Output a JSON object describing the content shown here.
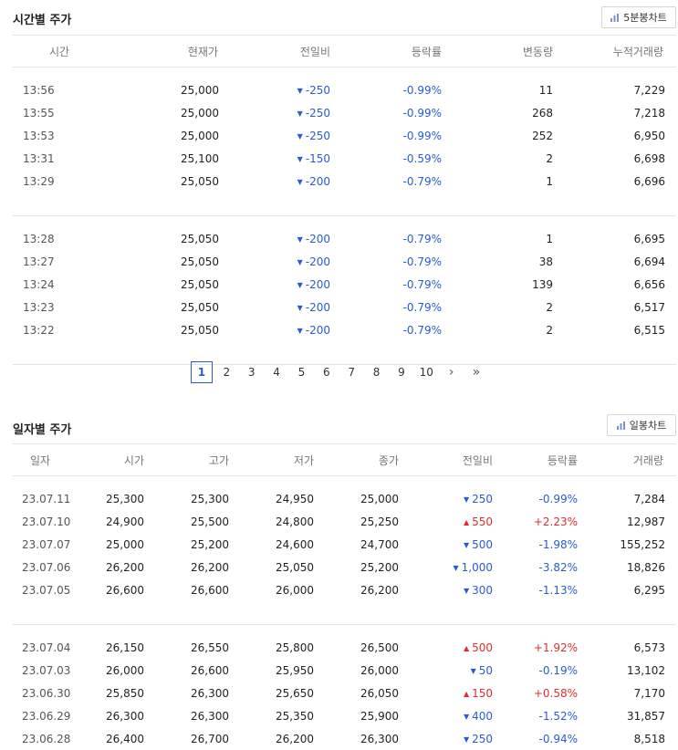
{
  "intraday": {
    "title": "시간별 주가",
    "chart_button": "5분봉차트",
    "columns": [
      "시간",
      "현재가",
      "전일비",
      "등락률",
      "변동량",
      "누적거래량"
    ],
    "groups": [
      [
        {
          "time": "13:56",
          "price": "25,000",
          "change": "-250",
          "rate": "-0.99%",
          "volume": "11",
          "cumulative": "7,229"
        },
        {
          "time": "13:55",
          "price": "25,000",
          "change": "-250",
          "rate": "-0.99%",
          "volume": "268",
          "cumulative": "7,218"
        },
        {
          "time": "13:53",
          "price": "25,000",
          "change": "-250",
          "rate": "-0.99%",
          "volume": "252",
          "cumulative": "6,950"
        },
        {
          "time": "13:31",
          "price": "25,100",
          "change": "-150",
          "rate": "-0.59%",
          "volume": "2",
          "cumulative": "6,698"
        },
        {
          "time": "13:29",
          "price": "25,050",
          "change": "-200",
          "rate": "-0.79%",
          "volume": "1",
          "cumulative": "6,696"
        }
      ],
      [
        {
          "time": "13:28",
          "price": "25,050",
          "change": "-200",
          "rate": "-0.79%",
          "volume": "1",
          "cumulative": "6,695"
        },
        {
          "time": "13:27",
          "price": "25,050",
          "change": "-200",
          "rate": "-0.79%",
          "volume": "38",
          "cumulative": "6,694"
        },
        {
          "time": "13:24",
          "price": "25,050",
          "change": "-200",
          "rate": "-0.79%",
          "volume": "139",
          "cumulative": "6,656"
        },
        {
          "time": "13:23",
          "price": "25,050",
          "change": "-200",
          "rate": "-0.79%",
          "volume": "2",
          "cumulative": "6,517"
        },
        {
          "time": "13:22",
          "price": "25,050",
          "change": "-200",
          "rate": "-0.79%",
          "volume": "2",
          "cumulative": "6,515"
        }
      ]
    ]
  },
  "pagination": {
    "pages": [
      "1",
      "2",
      "3",
      "4",
      "5",
      "6",
      "7",
      "8",
      "9",
      "10"
    ],
    "active": "1",
    "next": "›",
    "last": "»"
  },
  "daily": {
    "title": "일자별 주가",
    "chart_button": "일봉차트",
    "columns": [
      "일자",
      "시가",
      "고가",
      "저가",
      "종가",
      "전일비",
      "등락률",
      "거래량"
    ],
    "groups": [
      [
        {
          "date": "23.07.11",
          "open": "25,300",
          "high": "25,300",
          "low": "24,950",
          "close": "25,000",
          "dir": "down",
          "change": "250",
          "rate": "-0.99%",
          "volume": "7,284"
        },
        {
          "date": "23.07.10",
          "open": "24,900",
          "high": "25,500",
          "low": "24,800",
          "close": "25,250",
          "dir": "up",
          "change": "550",
          "rate": "+2.23%",
          "volume": "12,987"
        },
        {
          "date": "23.07.07",
          "open": "25,000",
          "high": "25,200",
          "low": "24,600",
          "close": "24,700",
          "dir": "down",
          "change": "500",
          "rate": "-1.98%",
          "volume": "155,252"
        },
        {
          "date": "23.07.06",
          "open": "26,200",
          "high": "26,200",
          "low": "25,050",
          "close": "25,200",
          "dir": "down",
          "change": "1,000",
          "rate": "-3.82%",
          "volume": "18,826"
        },
        {
          "date": "23.07.05",
          "open": "26,600",
          "high": "26,600",
          "low": "26,000",
          "close": "26,200",
          "dir": "down",
          "change": "300",
          "rate": "-1.13%",
          "volume": "6,295"
        }
      ],
      [
        {
          "date": "23.07.04",
          "open": "26,150",
          "high": "26,550",
          "low": "25,800",
          "close": "26,500",
          "dir": "up",
          "change": "500",
          "rate": "+1.92%",
          "volume": "6,573"
        },
        {
          "date": "23.07.03",
          "open": "26,000",
          "high": "26,600",
          "low": "25,950",
          "close": "26,000",
          "dir": "down",
          "change": "50",
          "rate": "-0.19%",
          "volume": "13,102"
        },
        {
          "date": "23.06.30",
          "open": "25,850",
          "high": "26,300",
          "low": "25,650",
          "close": "26,050",
          "dir": "up",
          "change": "150",
          "rate": "+0.58%",
          "volume": "7,170"
        },
        {
          "date": "23.06.29",
          "open": "26,300",
          "high": "26,300",
          "low": "25,350",
          "close": "25,900",
          "dir": "down",
          "change": "400",
          "rate": "-1.52%",
          "volume": "31,857"
        },
        {
          "date": "23.06.28",
          "open": "26,400",
          "high": "26,700",
          "low": "26,200",
          "close": "26,300",
          "dir": "down",
          "change": "250",
          "rate": "-0.94%",
          "volume": "8,518"
        }
      ]
    ]
  },
  "colors": {
    "down": "#2a5bd7",
    "up": "#e02d2d",
    "border": "#e3e3e3"
  },
  "icons": {
    "chart_button_icon": "bar-chart-icon"
  }
}
